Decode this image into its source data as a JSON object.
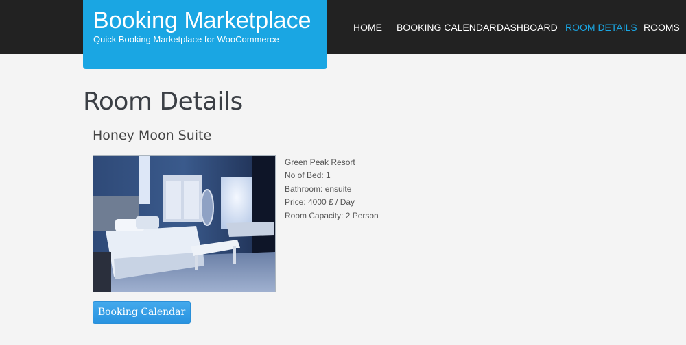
{
  "header": {
    "brand_title": "Booking Marketplace",
    "brand_tagline": "Quick Booking Marketplace for WooCommerce",
    "accent_color": "#1aa6e3",
    "background_color": "#222222",
    "nav": [
      {
        "label": "HOME",
        "active": false
      },
      {
        "label": "BOOKING CALENDAR",
        "active": false
      },
      {
        "label": "DASHBOARD",
        "active": false
      },
      {
        "label": "ROOM DETAILS",
        "active": true
      },
      {
        "label": "ROOMS",
        "active": false
      }
    ]
  },
  "main": {
    "page_title": "Room Details",
    "room_name": "Honey Moon Suite",
    "details": [
      "Green Peak Resort",
      "No of Bed: 1",
      "Bathroom: ensuite",
      "Price: 4000 £ / Day",
      "Room Capacity: 2 Person"
    ],
    "booking_button_label": "Booking Calendar"
  }
}
